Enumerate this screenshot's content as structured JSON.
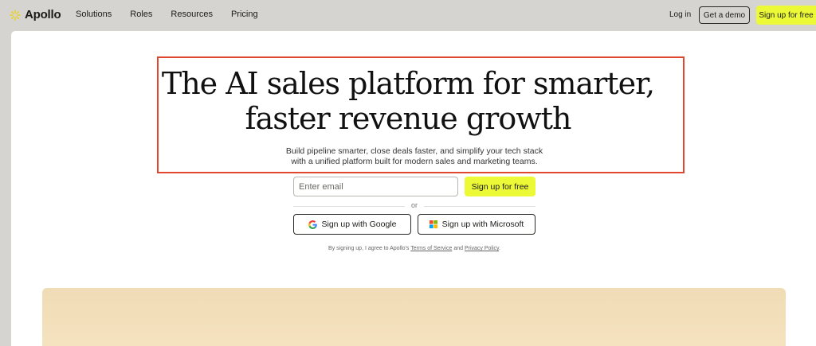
{
  "nav": {
    "brand": "Apollo",
    "links": [
      "Solutions",
      "Roles",
      "Resources",
      "Pricing"
    ],
    "login": "Log in",
    "demo": "Get a demo",
    "signup": "Sign up for free"
  },
  "hero": {
    "headline_line1": "The AI sales platform for smarter,",
    "headline_line2": "faster revenue growth",
    "sub_line1": "Build pipeline smarter, close deals faster, and simplify your tech stack",
    "sub_line2": "with a unified platform built for modern sales and marketing teams."
  },
  "form": {
    "email_placeholder": "Enter email",
    "signup": "Sign up for free",
    "or": "or",
    "google": "Sign up with Google",
    "microsoft": "Sign up with Microsoft"
  },
  "legal": {
    "prefix": "By signing up, I agree to Apollo's",
    "terms": "Terms of Service",
    "and": "and",
    "privacy": "Privacy Policy",
    "suffix": "."
  },
  "colors": {
    "accent": "#ebf936",
    "highlight": "#e0472e",
    "panel": "#f0dcb5"
  }
}
